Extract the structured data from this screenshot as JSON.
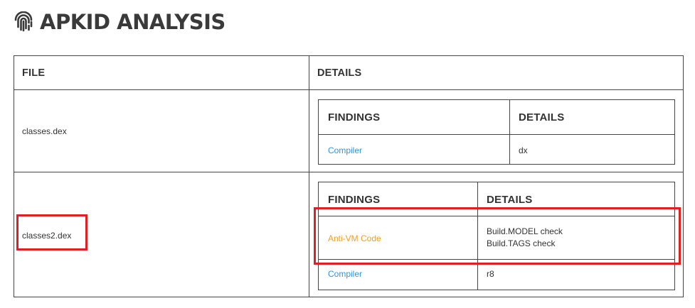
{
  "heading": {
    "icon": "fingerprint-icon",
    "title": "APKID ANALYSIS"
  },
  "outer_table": {
    "columns": [
      "FILE",
      "DETAILS"
    ],
    "rows": [
      {
        "file": "classes.dex",
        "inner": {
          "columns": [
            "FINDINGS",
            "DETAILS"
          ],
          "rows": [
            {
              "finding": "Compiler",
              "details": [
                "dx"
              ]
            }
          ]
        }
      },
      {
        "file": "classes2.dex",
        "inner": {
          "columns": [
            "FINDINGS",
            "DETAILS"
          ],
          "rows": [
            {
              "finding": "Anti-VM Code",
              "details": [
                "Build.MODEL check",
                "Build.TAGS check"
              ]
            },
            {
              "finding": "Compiler",
              "details": [
                "r8"
              ]
            }
          ]
        }
      }
    ]
  },
  "colors": {
    "link_blue": "#2f95dc",
    "warning_orange": "#f0a01e",
    "highlight_red": "#e02020"
  }
}
